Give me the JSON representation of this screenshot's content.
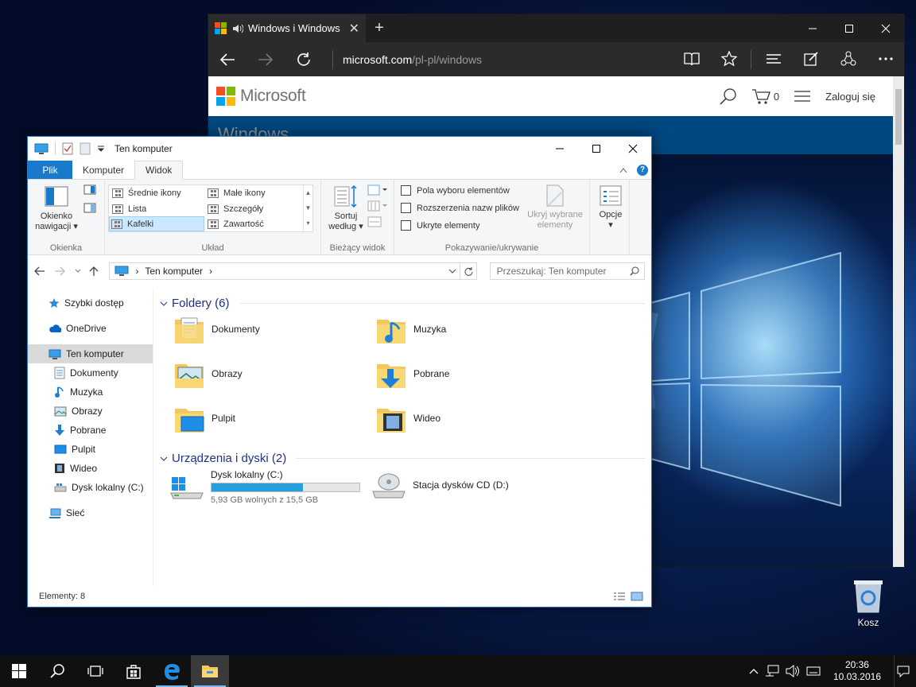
{
  "desktop": {
    "recycle_bin_label": "Kosz"
  },
  "browser": {
    "tab_title": "Windows i Windows",
    "url_host": "microsoft.com",
    "url_path": "/pl-pl/windows",
    "page": {
      "brand": "Microsoft",
      "cart_count": "0",
      "sign_in": "Zaloguj się",
      "nav_band": "Windows ⌄"
    },
    "colors": {
      "brand_blue": "#0078d7"
    }
  },
  "explorer": {
    "title": "Ten komputer",
    "ribbon_tabs": {
      "file": "Plik",
      "computer": "Komputer",
      "view": "Widok"
    },
    "ribbon": {
      "panes": {
        "nav_pane_line1": "Okienko",
        "nav_pane_line2": "nawigacji",
        "group": "Okienka"
      },
      "layout": {
        "items": [
          "Średnie ikony",
          "Małe ikony",
          "Lista",
          "Szczegóły",
          "Kafelki",
          "Zawartość"
        ],
        "selected": "Kafelki",
        "group": "Układ"
      },
      "current_view": {
        "sort_line1": "Sortuj",
        "sort_line2": "według",
        "group": "Bieżący widok"
      },
      "show_hide": {
        "item_checkboxes": "Pola wyboru elementów",
        "file_extensions": "Rozszerzenia nazw plików",
        "hidden_items": "Ukryte elementy",
        "hide_selected_line1": "Ukryj wybrane",
        "hide_selected_line2": "elementy",
        "group": "Pokazywanie/ukrywanie"
      },
      "options": "Opcje"
    },
    "address": {
      "location": "Ten komputer",
      "search_placeholder": "Przeszukaj: Ten komputer"
    },
    "nav_pane": {
      "quick_access": "Szybki dostęp",
      "onedrive": "OneDrive",
      "this_pc": "Ten komputer",
      "children": [
        "Dokumenty",
        "Muzyka",
        "Obrazy",
        "Pobrane",
        "Pulpit",
        "Wideo",
        "Dysk lokalny (C:)"
      ],
      "network": "Sieć"
    },
    "folders_header": "Foldery (6)",
    "folders": [
      "Dokumenty",
      "Muzyka",
      "Obrazy",
      "Pobrane",
      "Pulpit",
      "Wideo"
    ],
    "devices_header": "Urządzenia i dyski (2)",
    "drives": {
      "local": {
        "name": "Dysk lokalny (C:)",
        "free": "5,93 GB wolnych z 15,5 GB",
        "used_fraction": 0.62
      },
      "cd": {
        "name": "Stacja dysków CD (D:)"
      }
    },
    "status": {
      "items": "Elementy: 8"
    },
    "colors": {
      "accent": "#1979ca",
      "header_text": "#1e3287",
      "drive_fill": "#26a0da",
      "selection": "#cce8ff"
    }
  },
  "taskbar": {
    "time": "20:36",
    "date": "10.03.2016"
  }
}
